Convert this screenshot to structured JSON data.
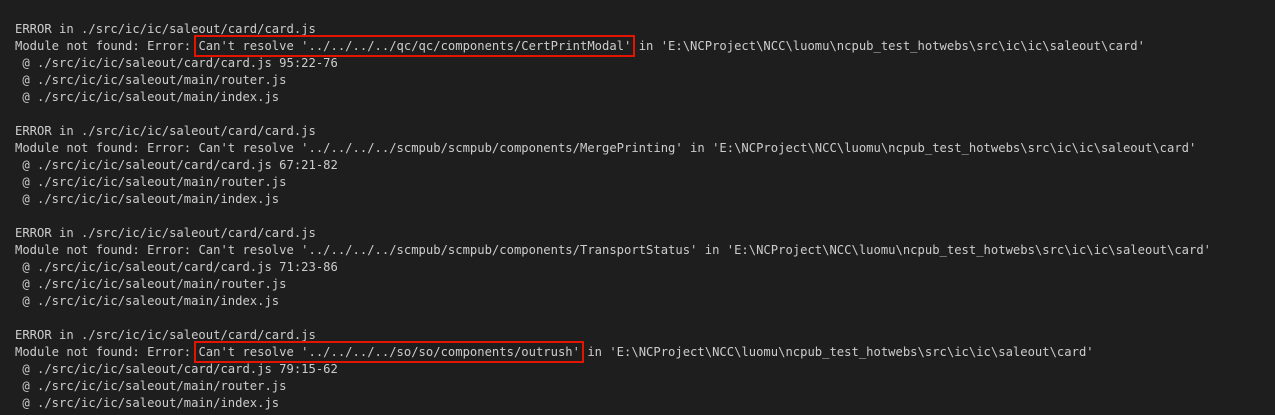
{
  "colors": {
    "background": "#1e1e1e",
    "text": "#cccccc",
    "highlight_box": "#e51400"
  },
  "errors": [
    {
      "header": "ERROR in ./src/ic/ic/saleout/card/card.js",
      "msg_prefix": "Module not found: Error: ",
      "msg_main": "Can't resolve '../../../../qc/qc/components/CertPrintModal'",
      "msg_suffix": " in 'E:\\NCProject\\NCC\\luomu\\ncpub_test_hotwebs\\src\\ic\\ic\\saleout\\card'",
      "trace": [
        " @ ./src/ic/ic/saleout/card/card.js 95:22-76",
        " @ ./src/ic/ic/saleout/main/router.js",
        " @ ./src/ic/ic/saleout/main/index.js"
      ]
    },
    {
      "header": "ERROR in ./src/ic/ic/saleout/card/card.js",
      "msg_prefix": "Module not found: Error: ",
      "msg_main": "Can't resolve '../../../../scmpub/scmpub/components/MergePrinting'",
      "msg_suffix": " in 'E:\\NCProject\\NCC\\luomu\\ncpub_test_hotwebs\\src\\ic\\ic\\saleout\\card'",
      "trace": [
        " @ ./src/ic/ic/saleout/card/card.js 67:21-82",
        " @ ./src/ic/ic/saleout/main/router.js",
        " @ ./src/ic/ic/saleout/main/index.js"
      ]
    },
    {
      "header": "ERROR in ./src/ic/ic/saleout/card/card.js",
      "msg_prefix": "Module not found: Error: ",
      "msg_main": "Can't resolve '../../../../scmpub/scmpub/components/TransportStatus'",
      "msg_suffix": " in 'E:\\NCProject\\NCC\\luomu\\ncpub_test_hotwebs\\src\\ic\\ic\\saleout\\card'",
      "trace": [
        " @ ./src/ic/ic/saleout/card/card.js 71:23-86",
        " @ ./src/ic/ic/saleout/main/router.js",
        " @ ./src/ic/ic/saleout/main/index.js"
      ]
    },
    {
      "header": "ERROR in ./src/ic/ic/saleout/card/card.js",
      "msg_prefix": "Module not found: Error: ",
      "msg_main": "Can't resolve '../../../../so/so/components/outrush'",
      "msg_suffix": " in 'E:\\NCProject\\NCC\\luomu\\ncpub_test_hotwebs\\src\\ic\\ic\\saleout\\card'",
      "trace": [
        " @ ./src/ic/ic/saleout/card/card.js 79:15-62",
        " @ ./src/ic/ic/saleout/main/router.js",
        " @ ./src/ic/ic/saleout/main/index.js"
      ]
    }
  ]
}
